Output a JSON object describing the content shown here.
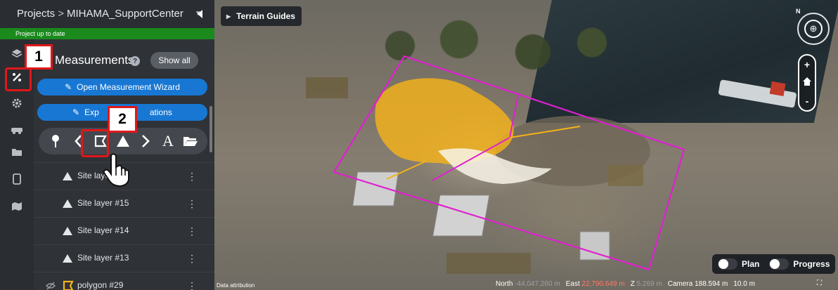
{
  "header": {
    "breadcrumb_root": "Projects",
    "breadcrumb_sep": ">",
    "project_name": "MIHAMA_SupportCenter",
    "status": "Project up to date"
  },
  "panel": {
    "title": "Measurements",
    "show_all": "Show all",
    "open_wizard": "Open Measurement Wizard",
    "export": "Export annotations",
    "export_visible_prefix": "Exp",
    "export_visible_suffix": "ations"
  },
  "layers": [
    {
      "label": "Site layer #16",
      "visible_label": "Site layer"
    },
    {
      "label": "Site layer #15"
    },
    {
      "label": "Site layer #14"
    },
    {
      "label": "Site layer #13"
    },
    {
      "label": "polygon #29"
    }
  ],
  "callouts": {
    "one": "1",
    "two": "2"
  },
  "map": {
    "terrain_guides": "Terrain Guides",
    "compass_label": "N",
    "zoom_in": "+",
    "zoom_out": "-",
    "toggle_plan": "Plan",
    "toggle_progress": "Progress",
    "attribution": "Data attribution",
    "north_label": "North",
    "north_value": "-44,047.260 m",
    "east_label": "East",
    "east_value": "22,790.649 m",
    "z_label": "Z",
    "z_value": "5.269 m",
    "camera_label": "Camera",
    "camera_value": "188.594 m",
    "scale_value": "10.0 m"
  },
  "colors": {
    "accent_blue": "#1877d3",
    "status_green": "#1a8a1d",
    "callout_red": "#e0181a",
    "polygon_magenta": "#e020d0",
    "volume_orange": "#f5b21a"
  }
}
